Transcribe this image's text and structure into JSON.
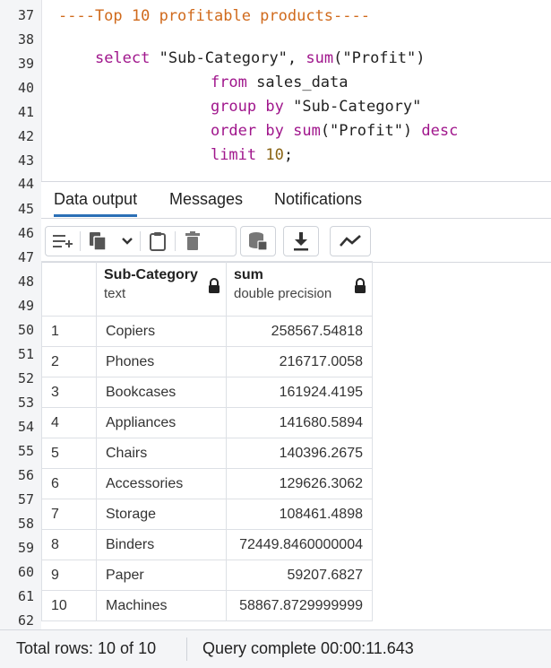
{
  "editor": {
    "line_numbers": [
      "37",
      "38",
      "39",
      "40",
      "41",
      "42",
      "43",
      "44",
      "45",
      "46",
      "47",
      "48",
      "49",
      "50",
      "51",
      "52",
      "53",
      "54",
      "55",
      "56",
      "57",
      "58",
      "59",
      "60",
      "61",
      "62"
    ],
    "line37": "----Top 10 profitable products----",
    "line38": {
      "kw": "select",
      "col": "\"Sub-Category\",",
      "fn": "sum",
      "arg": "(\"Profit\")"
    },
    "line39": {
      "kw": "from",
      "rest": "sales_data"
    },
    "line40": {
      "kw": "group by",
      "rest": "\"Sub-Category\""
    },
    "line41": {
      "kw": "order by",
      "fn": "sum",
      "arg": "(\"Profit\")",
      "desc": "desc"
    },
    "line42": {
      "kw": "limit",
      "num": "10",
      "end": ";"
    }
  },
  "tabs": [
    "Data output",
    "Messages",
    "Notifications"
  ],
  "active_tab": "Data output",
  "toolbar": {
    "icons": [
      "add-row-icon",
      "copy-icon",
      "chevron-down-icon",
      "paste-icon",
      "delete-icon",
      "save-data-icon",
      "download-icon",
      "graph-visualiser-icon"
    ]
  },
  "grid": {
    "columns": [
      {
        "name": "Sub-Category",
        "type": "text"
      },
      {
        "name": "sum",
        "type": "double precision"
      }
    ],
    "rows": [
      {
        "idx": "1",
        "cat": "Copiers",
        "sum": "258567.54818"
      },
      {
        "idx": "2",
        "cat": "Phones",
        "sum": "216717.0058"
      },
      {
        "idx": "3",
        "cat": "Bookcases",
        "sum": "161924.4195"
      },
      {
        "idx": "4",
        "cat": "Appliances",
        "sum": "141680.5894"
      },
      {
        "idx": "5",
        "cat": "Chairs",
        "sum": "140396.2675"
      },
      {
        "idx": "6",
        "cat": "Accessories",
        "sum": "129626.3062"
      },
      {
        "idx": "7",
        "cat": "Storage",
        "sum": "108461.4898"
      },
      {
        "idx": "8",
        "cat": "Binders",
        "sum": "72449.8460000004"
      },
      {
        "idx": "9",
        "cat": "Paper",
        "sum": "59207.6827"
      },
      {
        "idx": "10",
        "cat": "Machines",
        "sum": "58867.8729999999"
      }
    ]
  },
  "status": {
    "total_rows": "Total rows: 10 of 10",
    "query": "Query complete 00:00:11.643"
  },
  "colors": {
    "accent": "#2b6fb6",
    "keyword": "#a0168c",
    "comment": "#d06a1c",
    "number": "#8a6415"
  }
}
